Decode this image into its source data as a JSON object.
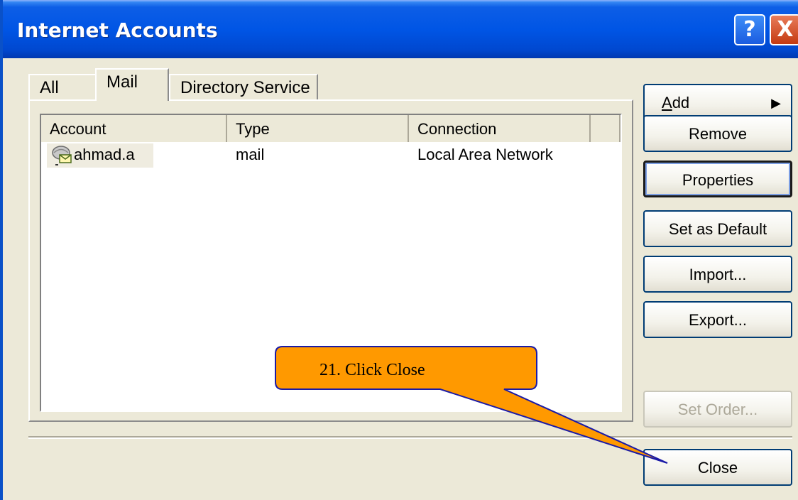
{
  "window": {
    "title": "Internet Accounts",
    "help_label": "?",
    "close_label": "X"
  },
  "tabs": [
    {
      "label": "All"
    },
    {
      "label": "Mail",
      "selected": true
    },
    {
      "label": "Directory Service"
    }
  ],
  "list": {
    "columns": [
      "Account",
      "Type",
      "Connection"
    ],
    "rows": [
      {
        "account": "ahmad.a",
        "type": "mail",
        "connection": "Local Area Network",
        "icon": "mail-account-icon"
      }
    ]
  },
  "buttons": {
    "add": {
      "prefix": "A",
      "rest": "dd"
    },
    "remove": "Remove",
    "properties": "Properties",
    "set_default": "Set as Default",
    "import": "Import...",
    "export": "Export...",
    "set_order": "Set Order...",
    "close": "Close"
  },
  "callout": {
    "text": "21. Click Close",
    "fill": "#ff9900",
    "stroke": "#1a1aa6"
  },
  "colors": {
    "titlebar": "#0055e5",
    "dialog_bg": "#ece9d8",
    "button_border": "#003c74"
  }
}
